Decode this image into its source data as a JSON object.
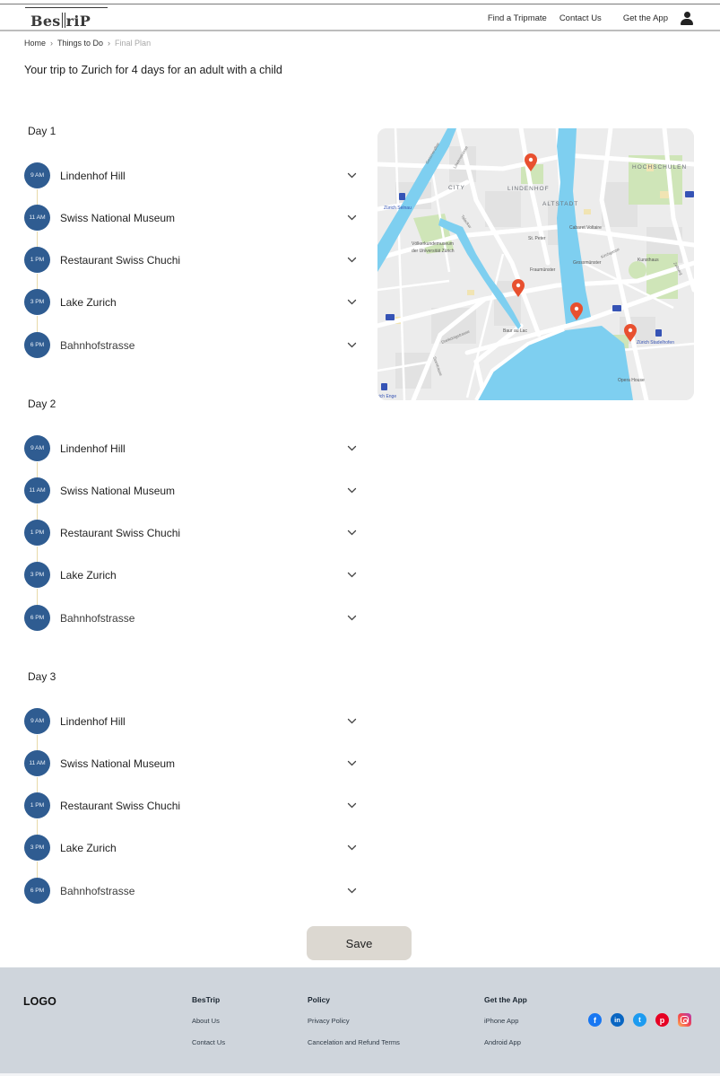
{
  "header": {
    "logo_left": "Bes",
    "logo_right": "riP",
    "nav": [
      {
        "label": "Find a Tripmate"
      },
      {
        "label": "Contact Us"
      },
      {
        "label": "Get the App"
      }
    ],
    "user_icon": "user-icon"
  },
  "breadcrumb": [
    {
      "label": "Home"
    },
    {
      "label": "Things to Do"
    },
    {
      "label": "Final Plan"
    }
  ],
  "breadcrumb_separator": "›",
  "page_title": "Your trip to Zurich for 4 days for an adult with a child",
  "days": [
    {
      "title": "Day 1",
      "stops": [
        {
          "time": "9 AM",
          "name": "Lindenhof Hill"
        },
        {
          "time": "11 AM",
          "name": "Swiss National Museum"
        },
        {
          "time": "1 PM",
          "name": "Restaurant Swiss Chuchi"
        },
        {
          "time": "3 PM",
          "name": "Lake Zurich"
        },
        {
          "time": "6 PM",
          "name": "Bahnhofstrasse"
        }
      ]
    },
    {
      "title": "Day 2",
      "stops": [
        {
          "time": "9 AM",
          "name": "Lindenhof Hill"
        },
        {
          "time": "11 AM",
          "name": "Swiss National Museum"
        },
        {
          "time": "1 PM",
          "name": "Restaurant Swiss Chuchi"
        },
        {
          "time": "3 PM",
          "name": "Lake Zurich"
        },
        {
          "time": "6 PM",
          "name": "Bahnhofstrasse"
        }
      ]
    },
    {
      "title": "Day 3",
      "stops": [
        {
          "time": "9 AM",
          "name": "Lindenhof Hill"
        },
        {
          "time": "11 AM",
          "name": "Swiss National Museum"
        },
        {
          "time": "1 PM",
          "name": "Restaurant Swiss Chuchi"
        },
        {
          "time": "3 PM",
          "name": "Lake Zurich"
        },
        {
          "time": "6 PM",
          "name": "Bahnhofstrasse"
        }
      ]
    }
  ],
  "map": {
    "labels": {
      "city": "CITY",
      "lindenhof": "LINDENHOF",
      "altstadt": "ALTSTADT",
      "hochschulen": "HOCHSCHULEN",
      "zurich_selnau": "Zürich Selnau",
      "voelkerkunde": "Völkerkundemuseum",
      "voelkerkunde2": "der Universität Zürich",
      "st_peter": "St. Peter",
      "cabaret": "Cabaret Voltaire",
      "fraumuenster": "Fraumünster",
      "grossmuenster": "Grossmünster",
      "kunsthaus": "Kunsthaus",
      "baur_au_lac": "Baur au Lac",
      "stadelhofen": "Zürich Stadelhofen",
      "opera": "Opera House",
      "enge": "rich Enge",
      "dreikoenig": "Dreikönigstrasse",
      "talacker": "Talacker",
      "zeltweg": "Zeltweg",
      "kirchgasse": "Kirchgasse",
      "lowenstrasse": "Löwenstrasse",
      "gessnerallee": "Gessnerallee",
      "seestrasse": "Seestrasse"
    },
    "pin_color": "#e8502f",
    "water_color": "#7ecff0",
    "pin_count": 4
  },
  "save_label": "Save",
  "footer": {
    "logo": "LOGO",
    "columns": [
      {
        "title": "BesTrip",
        "links": [
          "About Us",
          "Contact Us"
        ]
      },
      {
        "title": "Policy",
        "links": [
          "Privacy Policy",
          "Cancelation and Refund Terms"
        ]
      },
      {
        "title": "Get the App",
        "links": [
          "iPhone App",
          "Android App"
        ]
      }
    ],
    "socials": [
      "facebook",
      "linkedin",
      "twitter",
      "pinterest",
      "instagram"
    ]
  },
  "colors": {
    "time_circle": "#2f5c91",
    "save_button": "#dcd8d1",
    "footer_bg": "#cfd5dc"
  }
}
